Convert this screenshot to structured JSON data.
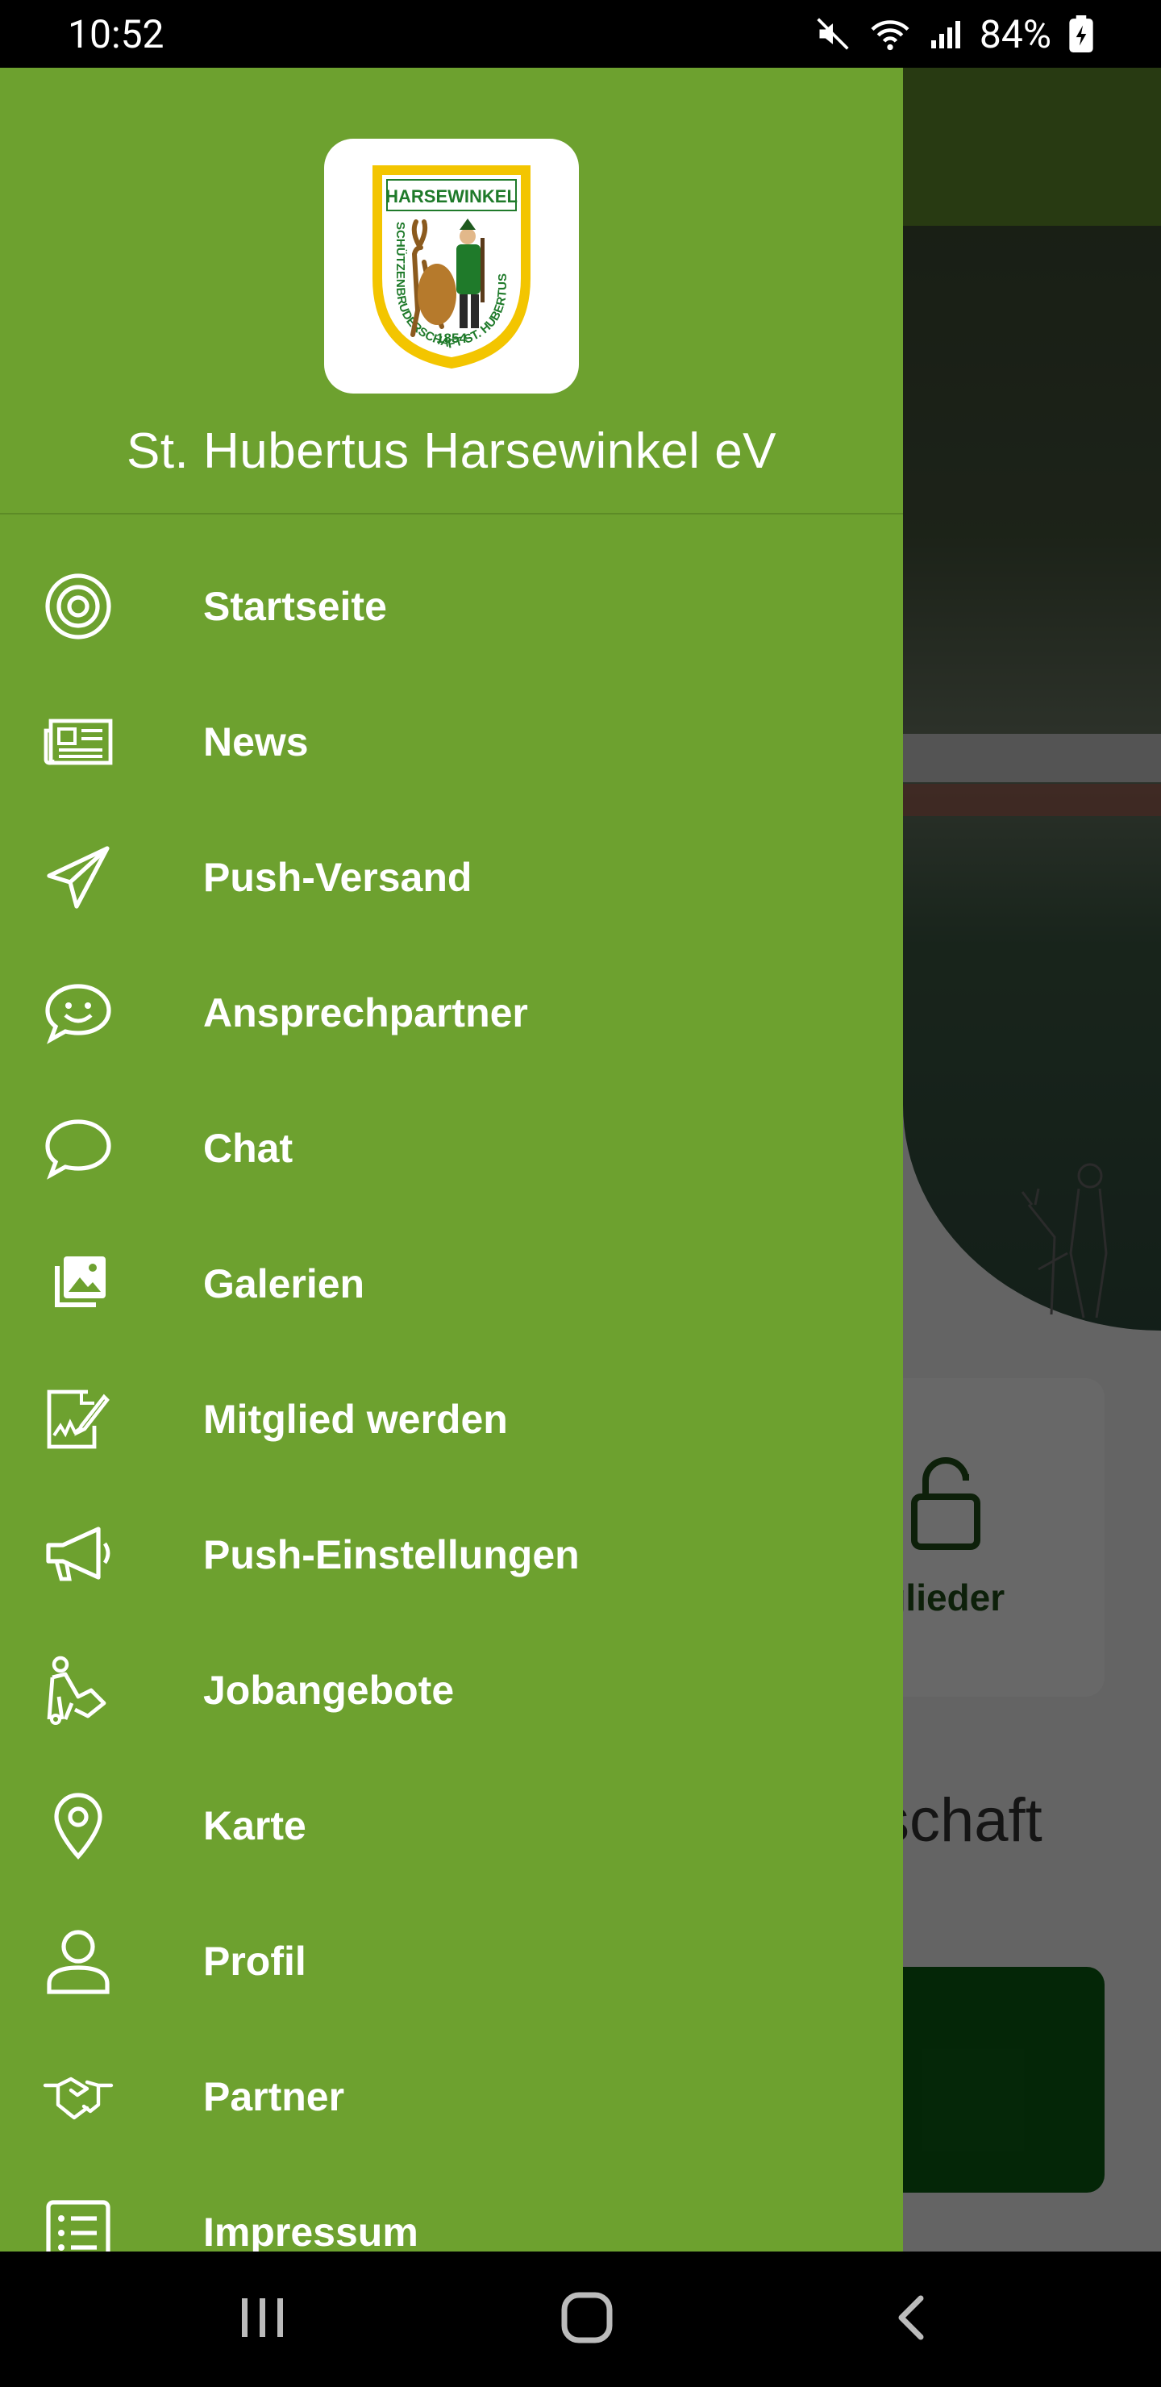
{
  "status_bar": {
    "time": "10:52",
    "battery": "84%",
    "icons": [
      "mute-icon",
      "wifi-icon",
      "signal-icon",
      "battery-icon"
    ]
  },
  "background_screen": {
    "card_label": "tglieder",
    "heading_partial": "schaft"
  },
  "drawer": {
    "logo": {
      "top_text": "HARSEWINKEL",
      "ring_text": "SCHÜTZENBRUDERSCHAFT ST. HUBERTUS",
      "year": "1854"
    },
    "club_name": "St. Hubertus Harsewinkel eV",
    "menu": [
      {
        "label": "Startseite",
        "icon": "target-icon"
      },
      {
        "label": "News",
        "icon": "newspaper-icon"
      },
      {
        "label": "Push-Versand",
        "icon": "paper-plane-icon"
      },
      {
        "label": "Ansprechpartner",
        "icon": "smiley-chat-icon"
      },
      {
        "label": "Chat",
        "icon": "chat-bubble-icon"
      },
      {
        "label": "Galerien",
        "icon": "gallery-icon"
      },
      {
        "label": "Mitglied werden",
        "icon": "signature-form-icon"
      },
      {
        "label": "Push-Einstellungen",
        "icon": "megaphone-icon"
      },
      {
        "label": "Jobangebote",
        "icon": "worker-icon"
      },
      {
        "label": "Karte",
        "icon": "map-pin-icon"
      },
      {
        "label": "Profil",
        "icon": "user-icon"
      },
      {
        "label": "Partner",
        "icon": "handshake-icon"
      },
      {
        "label": "Impressum",
        "icon": "list-icon"
      }
    ]
  },
  "colors": {
    "drawer_bg": "#6da12f",
    "topbar_bg": "#5f8a2c",
    "accent_dark_green": "#0b5c12"
  },
  "nav_bar": {
    "buttons": [
      "recent-apps-icon",
      "home-icon",
      "back-icon"
    ]
  }
}
